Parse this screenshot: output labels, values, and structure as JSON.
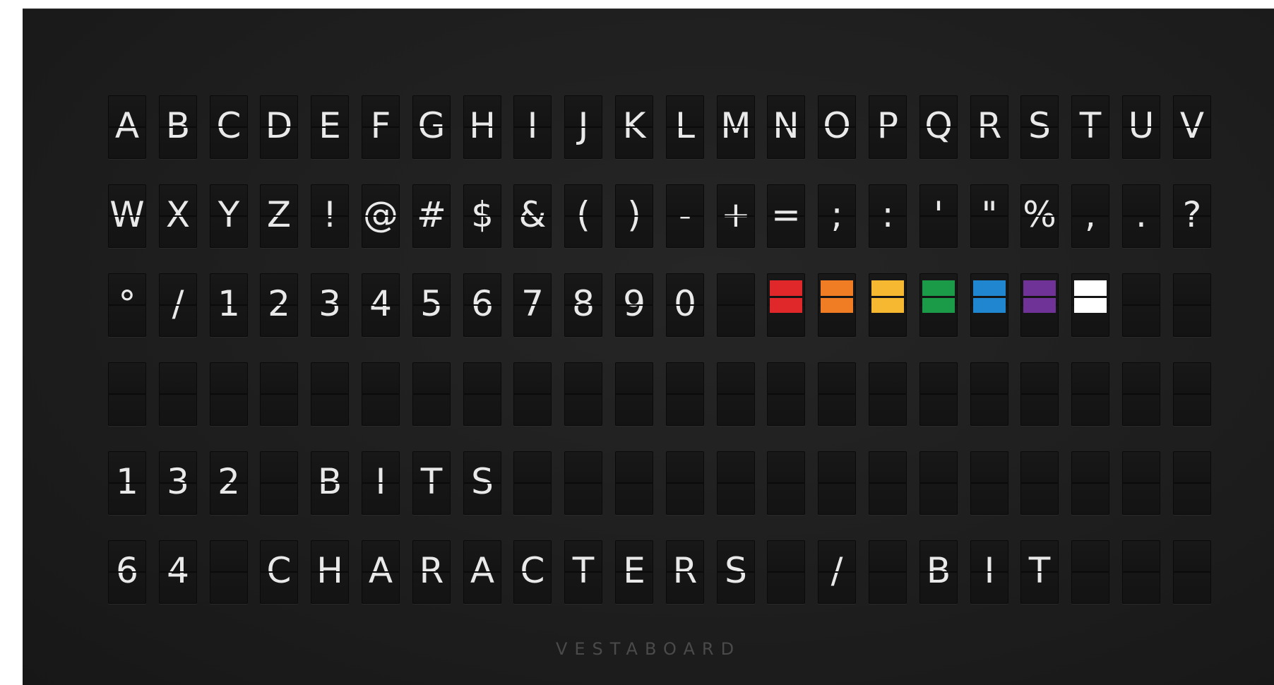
{
  "board": {
    "brand": "VESTABOARD",
    "rows": [
      [
        "A",
        "B",
        "C",
        "D",
        "E",
        "F",
        "G",
        "H",
        "I",
        "J",
        "K",
        "L",
        "M",
        "N",
        "O",
        "P",
        "Q",
        "R",
        "S",
        "T",
        "U",
        "V"
      ],
      [
        "W",
        "X",
        "Y",
        "Z",
        "!",
        "@",
        "#",
        "$",
        "&",
        "(",
        ")",
        "-",
        "+",
        "=",
        ";",
        ":",
        "'",
        "\"",
        "%",
        ",",
        ".",
        "?"
      ],
      [
        "°",
        "/",
        "1",
        "2",
        "3",
        "4",
        "5",
        "6",
        "7",
        "8",
        "9",
        "0",
        "",
        "#color:red",
        "#color:orange",
        "#color:yellow",
        "#color:green",
        "#color:blue",
        "#color:violet",
        "#color:white",
        "",
        ""
      ],
      [
        "",
        "",
        "",
        "",
        "",
        "",
        "",
        "",
        "",
        "",
        "",
        "",
        "",
        "",
        "",
        "",
        "",
        "",
        "",
        "",
        "",
        ""
      ],
      [
        "1",
        "3",
        "2",
        "",
        "B",
        "I",
        "T",
        "S",
        "",
        "",
        "",
        "",
        "",
        "",
        "",
        "",
        "",
        "",
        "",
        "",
        "",
        ""
      ],
      [
        "6",
        "4",
        "",
        "C",
        "H",
        "A",
        "R",
        "A",
        "C",
        "T",
        "E",
        "R",
        "S",
        "",
        "/",
        "",
        "B",
        "I",
        "T",
        "",
        "",
        ""
      ]
    ],
    "colors": {
      "red": "#e0282b",
      "orange": "#f07c24",
      "yellow": "#f5b830",
      "green": "#1b9a48",
      "blue": "#1f86cf",
      "violet": "#6f3297",
      "white": "#ffffff"
    }
  }
}
